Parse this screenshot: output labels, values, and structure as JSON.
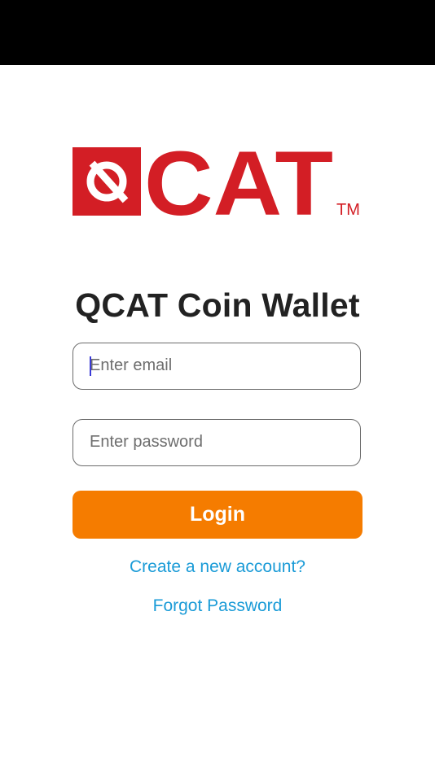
{
  "brand": {
    "logo_text": "CAT",
    "trademark": "TM",
    "accent_color": "#d31e25"
  },
  "login": {
    "title": "QCAT Coin Wallet",
    "email_placeholder": "Enter email",
    "password_placeholder": "Enter password",
    "login_label": "Login",
    "create_account_label": "Create a new account?",
    "forgot_password_label": "Forgot Password",
    "button_color": "#f57c00",
    "link_color": "#1a9bd7"
  }
}
